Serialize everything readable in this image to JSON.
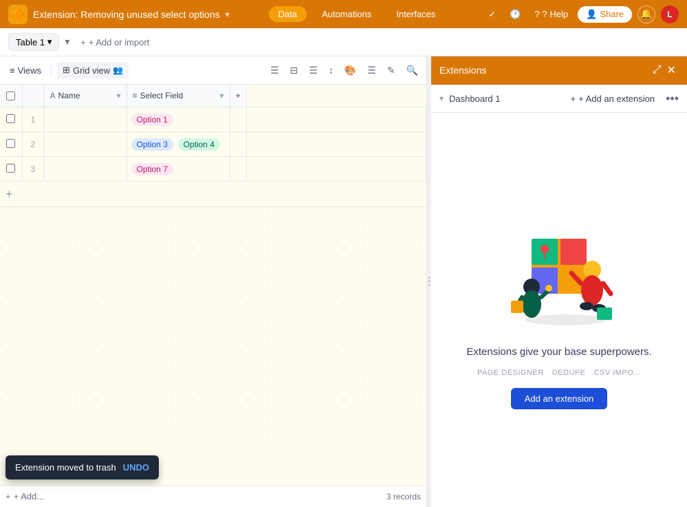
{
  "topnav": {
    "logo": "🔶",
    "title": "Extension: Removing unused select options",
    "chevron": "▾",
    "tabs": {
      "data": "Data",
      "automations": "Automations",
      "interfaces": "Interfaces"
    },
    "actions": {
      "check": "✓",
      "history": "🕐",
      "help": "? Help",
      "share": "Share",
      "share_icon": "👤",
      "bell": "🔔",
      "avatar": "L"
    }
  },
  "toolbar": {
    "table_name": "Table 1",
    "add_import": "+ Add or import",
    "chevron": "▾"
  },
  "viewsbar": {
    "views_label": "Views",
    "grid_view": "Grid view",
    "icons": [
      "≡",
      "☰",
      "⊞",
      "🔀",
      "↕",
      "🎨",
      "☰",
      "✎",
      "🔍"
    ]
  },
  "grid": {
    "headers": {
      "checkbox": "",
      "rownum": "",
      "name": "Name",
      "name_icon": "A",
      "select_field": "Select Field",
      "select_icon": "≡",
      "add": "+"
    },
    "rows": [
      {
        "num": "1",
        "name": "",
        "options": [
          {
            "label": "Option 1",
            "style": "pink"
          }
        ]
      },
      {
        "num": "2",
        "name": "",
        "options": [
          {
            "label": "Option 3",
            "style": "blue"
          },
          {
            "label": "Option 4",
            "style": "teal"
          }
        ]
      },
      {
        "num": "3",
        "name": "",
        "options": [
          {
            "label": "Option 7",
            "style": "pink"
          }
        ]
      }
    ],
    "add_row": "+",
    "record_count": "3 records",
    "add_field_btn": "+ Add..."
  },
  "extensions": {
    "panel_title": "Extensions",
    "expand_icon": "⤢",
    "close_icon": "✕",
    "dashboard_name": "Dashboard 1",
    "add_extension": "+ Add an extension",
    "more_icon": "•••",
    "illustration_alt": "people building a dashboard",
    "description": "Extensions give your base superpowers.",
    "tags": [
      "PAGE DESIGNER",
      "DEDUPE",
      "CSV IMPO..."
    ],
    "add_btn": "Add an extension"
  },
  "snackbar": {
    "message": "Extension moved to trash",
    "undo": "UNDO"
  }
}
